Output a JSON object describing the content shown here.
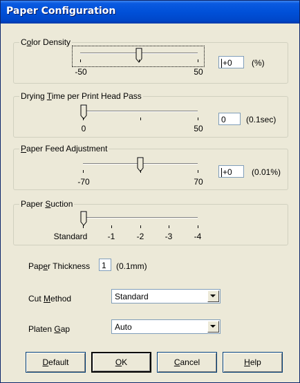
{
  "title": "Paper Configuration",
  "color_density": {
    "title_pre": "C",
    "title_ul": "o",
    "title_post": "lor Density",
    "min_label": "-50",
    "max_label": "50",
    "value": "+0",
    "unit": "(%)",
    "slider_fraction": 0.5
  },
  "drying_time": {
    "title_pre": "Drying ",
    "title_ul": "T",
    "title_post": "ime per Print Head Pass",
    "min_label": "0",
    "max_label": "50",
    "value": "0",
    "unit": "(0.1sec)",
    "slider_fraction": 0.0
  },
  "paper_feed": {
    "title_pre": "",
    "title_ul": "P",
    "title_post": "aper Feed Adjustment",
    "min_label": "-70",
    "max_label": "70",
    "value": "+0",
    "unit": "(0.01%)",
    "slider_fraction": 0.5
  },
  "paper_suction": {
    "title_pre": "Paper ",
    "title_ul": "S",
    "title_post": "uction",
    "labels": [
      "Standard",
      "-1",
      "-2",
      "-3",
      "-4"
    ],
    "slider_fraction": 0.0
  },
  "paper_thickness": {
    "label_pre": "Pap",
    "label_ul": "e",
    "label_post": "r Thickness",
    "value": "1",
    "unit": "(0.1mm)"
  },
  "cut_method": {
    "label_pre": "Cut ",
    "label_ul": "M",
    "label_post": "ethod",
    "selected": "Standard"
  },
  "platen_gap": {
    "label_pre": "Platen ",
    "label_ul": "G",
    "label_post": "ap",
    "selected": "Auto"
  },
  "buttons": {
    "default_ul": "D",
    "default_post": "efault",
    "ok_ul": "O",
    "ok_post": "K",
    "cancel_ul": "C",
    "cancel_post": "ancel",
    "help_ul": "H",
    "help_post": "elp"
  }
}
